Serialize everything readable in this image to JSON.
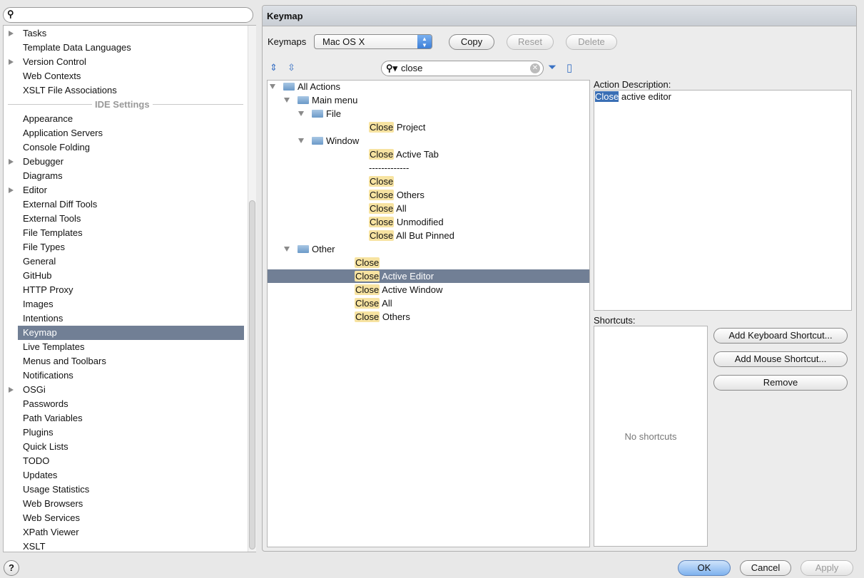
{
  "left": {
    "search_value": "",
    "items": [
      {
        "label": "Tasks",
        "expandable": true
      },
      {
        "label": "Template Data Languages"
      },
      {
        "label": "Version Control",
        "expandable": true
      },
      {
        "label": "Web Contexts"
      },
      {
        "label": "XSLT File Associations"
      },
      {
        "section": "IDE Settings"
      },
      {
        "label": "Appearance"
      },
      {
        "label": "Application Servers"
      },
      {
        "label": "Console Folding"
      },
      {
        "label": "Debugger",
        "expandable": true
      },
      {
        "label": "Diagrams"
      },
      {
        "label": "Editor",
        "expandable": true
      },
      {
        "label": "External Diff Tools"
      },
      {
        "label": "External Tools"
      },
      {
        "label": "File Templates"
      },
      {
        "label": "File Types"
      },
      {
        "label": "General"
      },
      {
        "label": "GitHub"
      },
      {
        "label": "HTTP Proxy"
      },
      {
        "label": "Images"
      },
      {
        "label": "Intentions"
      },
      {
        "label": "Keymap",
        "selected": true
      },
      {
        "label": "Live Templates"
      },
      {
        "label": "Menus and Toolbars"
      },
      {
        "label": "Notifications"
      },
      {
        "label": "OSGi",
        "expandable": true
      },
      {
        "label": "Passwords"
      },
      {
        "label": "Path Variables"
      },
      {
        "label": "Plugins"
      },
      {
        "label": "Quick Lists"
      },
      {
        "label": "TODO"
      },
      {
        "label": "Updates"
      },
      {
        "label": "Usage Statistics"
      },
      {
        "label": "Web Browsers"
      },
      {
        "label": "Web Services"
      },
      {
        "label": "XPath Viewer"
      },
      {
        "label": "XSLT"
      }
    ]
  },
  "header": {
    "title": "Keymap"
  },
  "keymaps": {
    "label": "Keymaps",
    "selected": "Mac OS X",
    "copy": "Copy",
    "reset": "Reset",
    "delete": "Delete"
  },
  "filter": {
    "value": "close"
  },
  "tree": [
    {
      "level": 0,
      "folder": true,
      "label": "All Actions"
    },
    {
      "level": 1,
      "folder": true,
      "label": "Main menu"
    },
    {
      "level": 2,
      "folder": true,
      "label": "File"
    },
    {
      "level": 3,
      "hl": "Close",
      "label": " Project"
    },
    {
      "level": 2,
      "folder": true,
      "label": "Window"
    },
    {
      "level": 3,
      "hl": "Close",
      "label": " Active Tab"
    },
    {
      "level": 3,
      "label": "-------------"
    },
    {
      "level": 3,
      "hl": "Close",
      "label": ""
    },
    {
      "level": 3,
      "hl": "Close",
      "label": " Others"
    },
    {
      "level": 3,
      "hl": "Close",
      "label": " All"
    },
    {
      "level": 3,
      "hl": "Close",
      "label": " Unmodified"
    },
    {
      "level": 3,
      "hl": "Close",
      "label": " All But Pinned"
    },
    {
      "level": 1,
      "folder": true,
      "label": "Other"
    },
    {
      "level": 2,
      "hl": "Close",
      "label": ""
    },
    {
      "level": 2,
      "hl": "Close",
      "label": " Active Editor",
      "selected": true
    },
    {
      "level": 2,
      "hl": "Close",
      "label": " Active Window"
    },
    {
      "level": 2,
      "hl": "Close",
      "label": " All"
    },
    {
      "level": 2,
      "hl": "Close",
      "label": " Others"
    }
  ],
  "description": {
    "label": "Action Description:",
    "highlight": "Close",
    "rest": " active editor"
  },
  "shortcuts": {
    "label": "Shortcuts:",
    "empty": "No shortcuts",
    "add_keyboard": "Add Keyboard Shortcut...",
    "add_mouse": "Add Mouse Shortcut...",
    "remove": "Remove"
  },
  "footer": {
    "help": "?",
    "ok": "OK",
    "cancel": "Cancel",
    "apply": "Apply"
  },
  "colors": {
    "selection": "#717f95",
    "highlight": "#f7e3a1"
  }
}
